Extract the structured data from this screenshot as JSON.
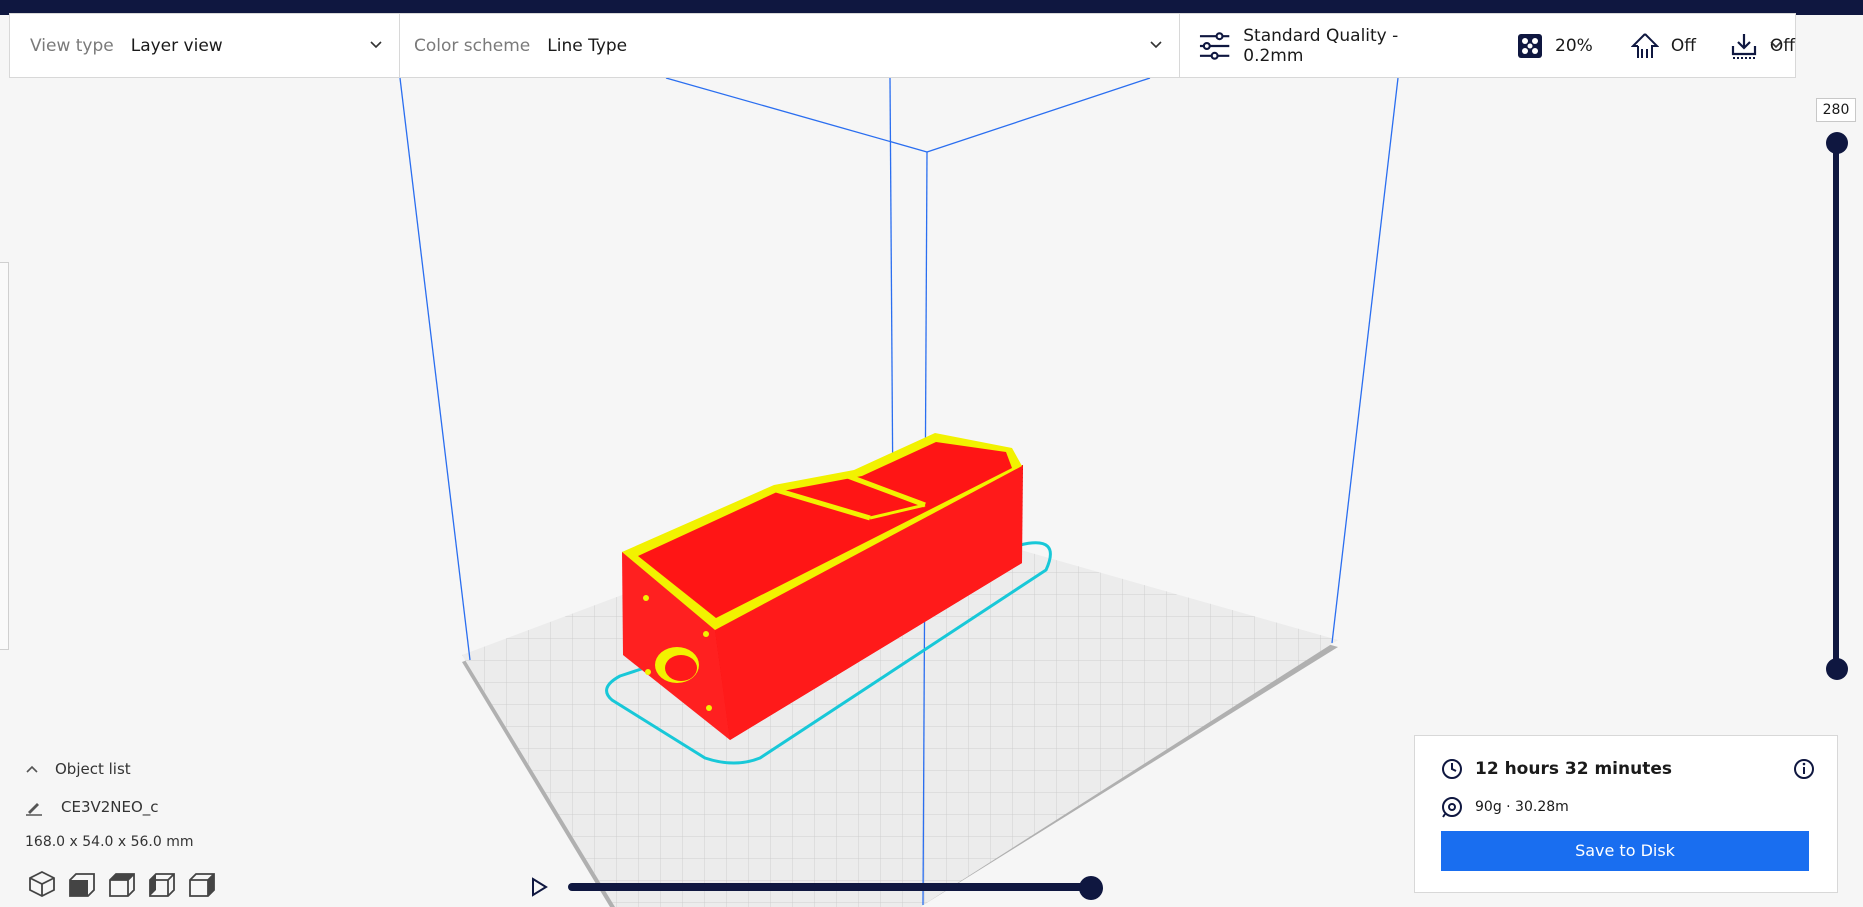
{
  "toolbar": {
    "view_type_label": "View type",
    "view_type_value": "Layer view",
    "color_scheme_label": "Color scheme",
    "color_scheme_value": "Line Type",
    "print_profile": "Standard Quality - 0.2mm",
    "infill": "20%",
    "support": "Off",
    "adhesion": "Off"
  },
  "layer_slider": {
    "top_layer": "280"
  },
  "object_list": {
    "header": "Object list",
    "object_name": "CE3V2NEO_c",
    "dimensions": "168.0 x 54.0 x 56.0 mm"
  },
  "estimate": {
    "time": "12 hours 32 minutes",
    "material": "90g · 30.28m",
    "save_label": "Save to Disk"
  },
  "colors": {
    "dark_navy": "#0f1740",
    "accent_blue": "#196ef0",
    "model_red": "#ff1a1a",
    "model_yellow": "#f4f400",
    "skirt_cyan": "#18c8d8",
    "build_volume_blue": "#2a6ef0"
  }
}
